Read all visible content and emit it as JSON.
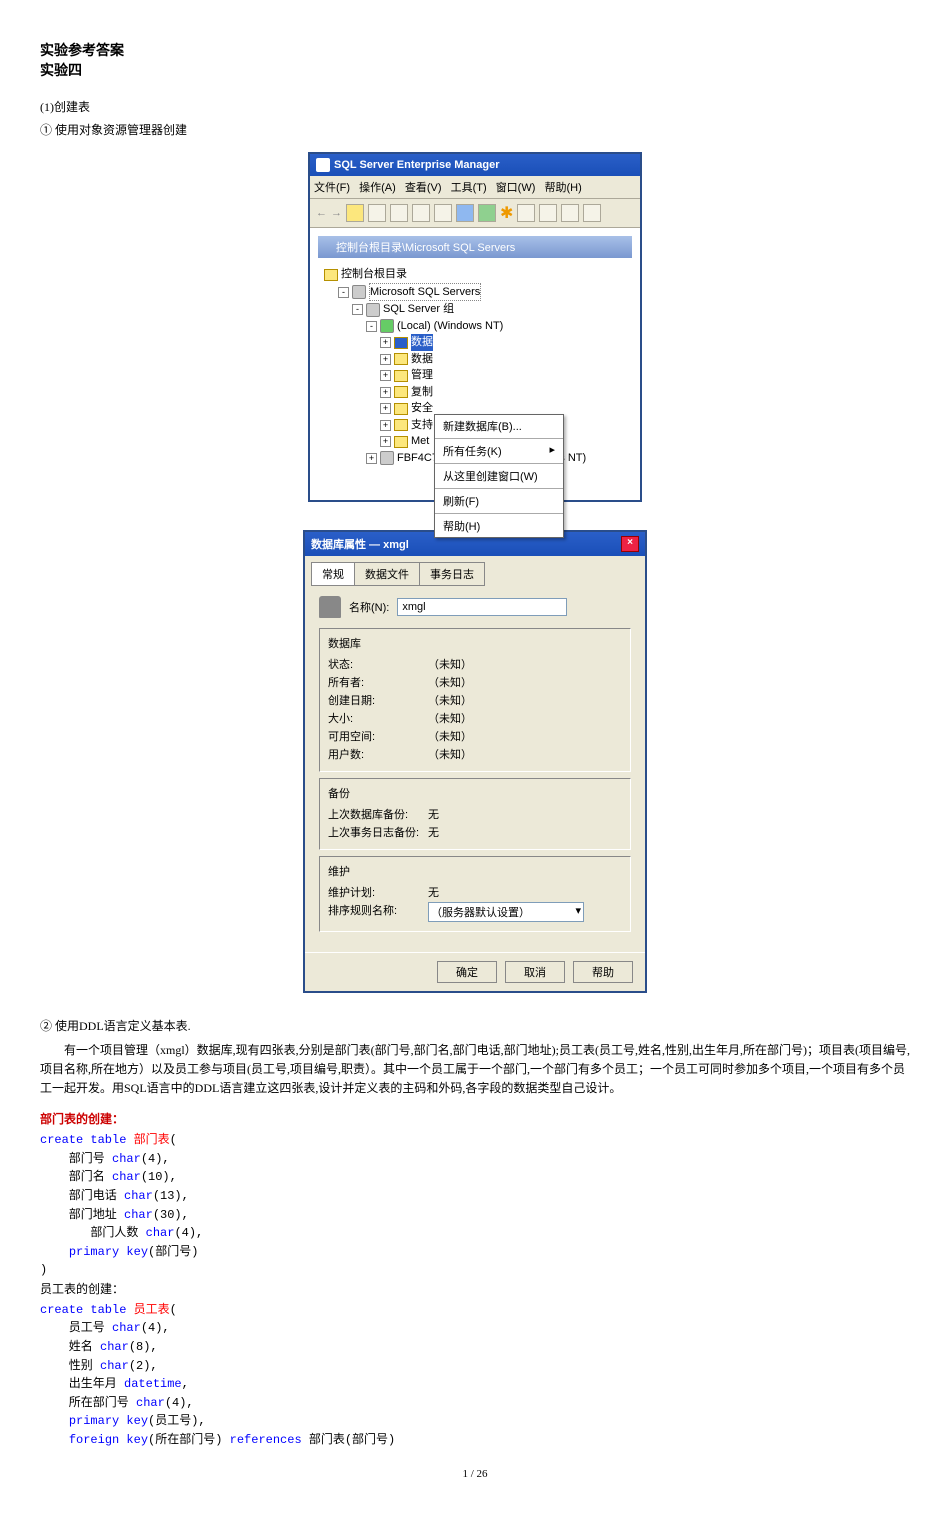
{
  "heading1": "实验参考答案",
  "heading2": "实验四",
  "step1": "(1)创建表",
  "step1a": "① 使用对象资源管理器创建",
  "em_title": "SQL Server Enterprise Manager",
  "menus": [
    "文件(F)",
    "操作(A)",
    "查看(V)",
    "工具(T)",
    "窗口(W)",
    "帮助(H)"
  ],
  "subwin_title": "控制台根目录\\Microsoft SQL Servers",
  "tree": {
    "root": "控制台根目录",
    "n1": "Microsoft SQL Servers",
    "n2": "SQL Server 组",
    "n3": "(Local) (Windows NT)",
    "items": [
      "数据",
      "数据",
      "管理",
      "复制",
      "安全",
      "支持",
      "Met"
    ],
    "other": "FBF4C7",
    "right_hint": "ndows NT)"
  },
  "ctx": {
    "m1": "新建数据库(B)...",
    "m2": "所有任务(K)",
    "m3": "从这里创建窗口(W)",
    "m4": "刷新(F)",
    "m5": "帮助(H)"
  },
  "dlg": {
    "title": "数据库属性 — xmgl",
    "tabs": [
      "常规",
      "数据文件",
      "事务日志"
    ],
    "name_label": "名称(N):",
    "name_value": "xmgl",
    "fs1": "数据库",
    "rows1": [
      {
        "label": "状态:",
        "val": "（未知）"
      },
      {
        "label": "所有者:",
        "val": "（未知）"
      },
      {
        "label": "创建日期:",
        "val": "（未知）"
      },
      {
        "label": "大小:",
        "val": "（未知）"
      },
      {
        "label": "可用空间:",
        "val": "（未知）"
      },
      {
        "label": "用户数:",
        "val": "（未知）"
      }
    ],
    "fs2": "备份",
    "rows2": [
      {
        "label": "上次数据库备份:",
        "val": "无"
      },
      {
        "label": "上次事务日志备份:",
        "val": "无"
      }
    ],
    "fs3": "维护",
    "rows3": [
      {
        "label": "维护计划:",
        "val": "无"
      },
      {
        "label": "排序规则名称:",
        "val": "（服务器默认设置）"
      }
    ],
    "btns": [
      "确定",
      "取消",
      "帮助"
    ]
  },
  "step2": "② 使用DDL语言定义基本表.",
  "desc1": "　　有一个项目管理（xmgl）数据库,现有四张表,分别是部门表(部门号,部门名,部门电话,部门地址);员工表(员工号,姓名,性别,出生年月,所在部门号)；项目表(项目编号,项目名称,所在地方）以及员工参与项目(员工号,项目编号,职责）。其中一个员工属于一个部门,一个部门有多个员工；一个员工可同时参加多个项目,一个项目有多个员工一起开发。用SQL语言中的DDL语言建立这四张表,设计并定义表的主码和外码,各字段的数据类型自己设计。",
  "sect1": "部门表的创建：",
  "code1": {
    "l1a": "create table ",
    "l1b": "部门表",
    "l1c": "(",
    "l2": "    部门号 ",
    "l2b": "char",
    "l2c": "(4),",
    "l3": "    部门名 ",
    "l3b": "char",
    "l3c": "(10),",
    "l4": "    部门电话 ",
    "l4b": "char",
    "l4c": "(13),",
    "l5": "    部门地址 ",
    "l5b": "char",
    "l5c": "(30),",
    "l6": "       部门人数 ",
    "l6b": "char",
    "l6c": "(4),",
    "l7": "    ",
    "l7a": "primary key",
    "l7b": "(部门号)",
    "l8": ")"
  },
  "sect2": "员工表的创建：",
  "code2": {
    "l1a": "create table ",
    "l1b": "员工表",
    "l1c": "(",
    "l2": "    员工号 ",
    "l2b": "char",
    "l2c": "(4),",
    "l3": "    姓名 ",
    "l3b": "char",
    "l3c": "(8),",
    "l4": "    性别 ",
    "l4b": "char",
    "l4c": "(2),",
    "l5": "    出生年月 ",
    "l5b": "datetime",
    "l5c": ",",
    "l6": "    所在部门号 ",
    "l6b": "char",
    "l6c": "(4),",
    "l7": "    ",
    "l7a": "primary key",
    "l7b": "(员工号),",
    "l8": "    ",
    "l8a": "foreign key",
    "l8b": "(所在部门号) ",
    "l8c": "references",
    "l8d": " 部门表(部门号)"
  },
  "footer": "1 / 26"
}
